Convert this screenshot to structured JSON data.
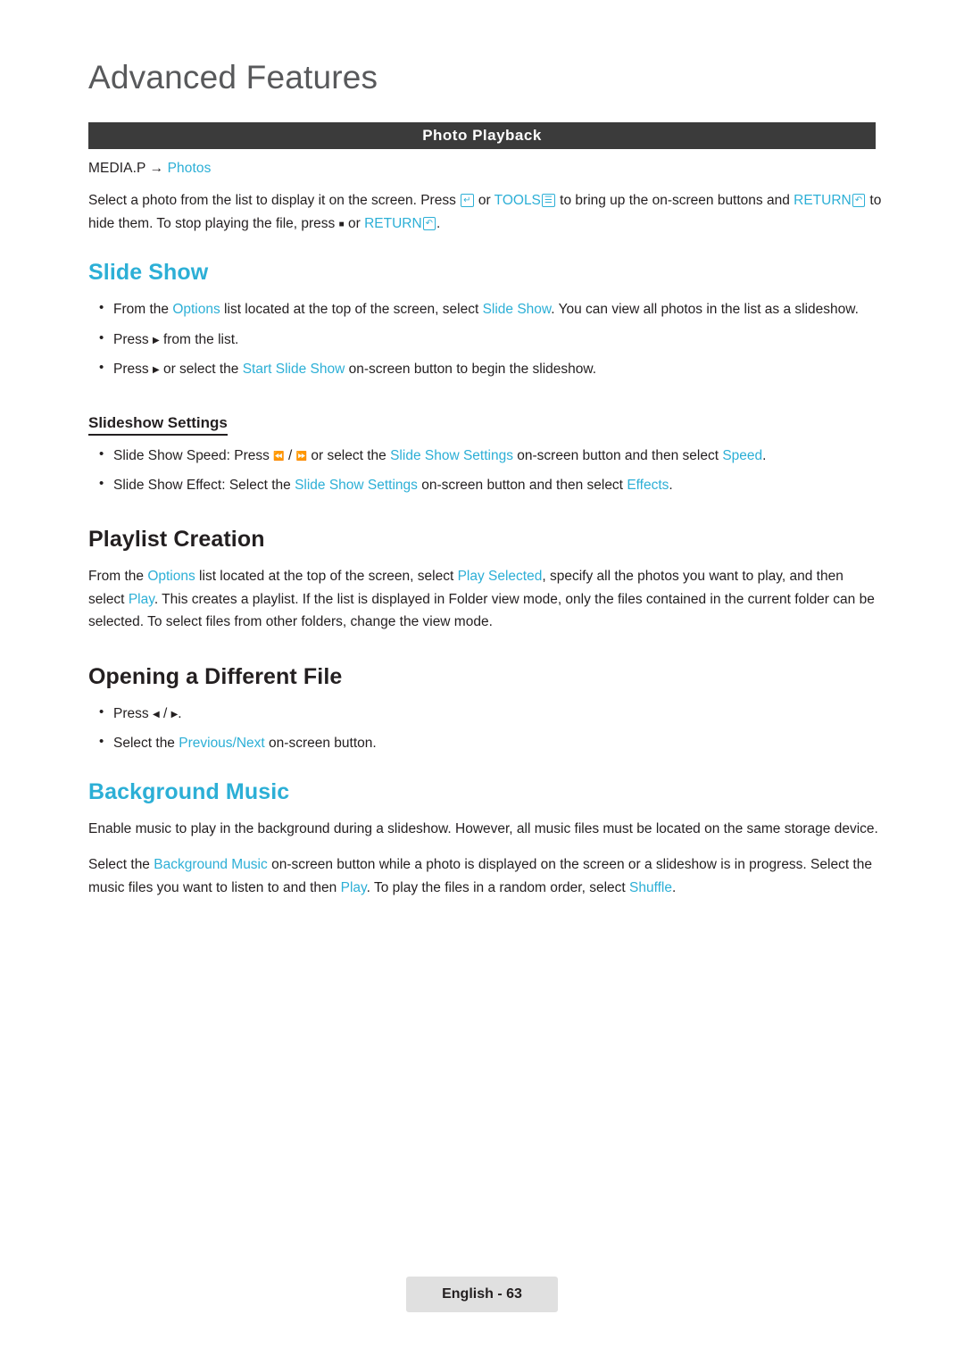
{
  "header": {
    "chapter_title": "Advanced Features",
    "section_bar_title": "Photo Playback"
  },
  "breadcrumb": {
    "root": "MEDIA.P",
    "arrow": "→",
    "leaf": "Photos"
  },
  "intro": {
    "t1": "Select a photo from the list to display it on the screen. Press ",
    "k_enter": "↵",
    "t2": " or ",
    "k_tools_label": "TOOLS",
    "k_tools": "☰",
    "t3": " to bring up the on-screen buttons and ",
    "k_return_label": "RETURN",
    "k_return": "↶",
    "t4": " to hide them. To stop playing the file, press ",
    "k_stop": "■",
    "t5": " or ",
    "k_return_label2": "RETURN",
    "k_return2": "↶",
    "t6": "."
  },
  "slide_show": {
    "heading": "Slide Show",
    "bullets": [
      {
        "parts": [
          {
            "text": "From the ",
            "style": "plain"
          },
          {
            "text": "Options",
            "style": "cyan"
          },
          {
            "text": " list located at the top of the screen, select ",
            "style": "plain"
          },
          {
            "text": "Slide Show",
            "style": "cyan"
          },
          {
            "text": ". You can view all photos in the list as a slideshow.",
            "style": "plain"
          }
        ]
      },
      {
        "parts": [
          {
            "text": "Press ",
            "style": "plain"
          },
          {
            "text": "▶",
            "style": "glyph-sm"
          },
          {
            "text": " from the list.",
            "style": "plain"
          }
        ]
      },
      {
        "parts": [
          {
            "text": "Press ",
            "style": "plain"
          },
          {
            "text": "▶",
            "style": "glyph-sm"
          },
          {
            "text": " or select the ",
            "style": "plain"
          },
          {
            "text": "Start Slide Show",
            "style": "cyan"
          },
          {
            "text": " on-screen button to begin the slideshow.",
            "style": "plain"
          }
        ]
      }
    ],
    "sub_heading": "Slideshow Settings",
    "sub_bullets": [
      {
        "parts": [
          {
            "text": "Slide Show Speed: Press ",
            "style": "plain"
          },
          {
            "text": "⏪",
            "style": "glyph-sm"
          },
          {
            "text": " / ",
            "style": "plain"
          },
          {
            "text": "⏩",
            "style": "glyph-sm"
          },
          {
            "text": " or select the ",
            "style": "plain"
          },
          {
            "text": "Slide Show Settings",
            "style": "cyan"
          },
          {
            "text": " on-screen button and then select ",
            "style": "plain"
          },
          {
            "text": "Speed",
            "style": "cyan"
          },
          {
            "text": ".",
            "style": "plain"
          }
        ]
      },
      {
        "parts": [
          {
            "text": "Slide Show Effect: Select the ",
            "style": "plain"
          },
          {
            "text": "Slide Show Settings",
            "style": "cyan"
          },
          {
            "text": " on-screen button and then select ",
            "style": "plain"
          },
          {
            "text": "Effects",
            "style": "cyan"
          },
          {
            "text": ".",
            "style": "plain"
          }
        ]
      }
    ]
  },
  "playlist_creation": {
    "heading": "Playlist Creation",
    "paragraph_parts": [
      {
        "text": "From the ",
        "style": "plain"
      },
      {
        "text": "Options",
        "style": "cyan"
      },
      {
        "text": " list located at the top of the screen, select ",
        "style": "plain"
      },
      {
        "text": "Play Selected",
        "style": "cyan"
      },
      {
        "text": ", specify all the photos you want to play, and then select ",
        "style": "plain"
      },
      {
        "text": "Play",
        "style": "cyan"
      },
      {
        "text": ". This creates a playlist. If the list is displayed in Folder view mode, only the files contained in the current folder can be selected. To select files from other folders, change the view mode.",
        "style": "plain"
      }
    ]
  },
  "opening_different_file": {
    "heading": "Opening a Different File",
    "bullets": [
      {
        "parts": [
          {
            "text": "Press ",
            "style": "plain"
          },
          {
            "text": "◀",
            "style": "glyph-cy"
          },
          {
            "text": " / ",
            "style": "plain"
          },
          {
            "text": "▶",
            "style": "glyph-cy"
          },
          {
            "text": ".",
            "style": "plain"
          }
        ]
      },
      {
        "parts": [
          {
            "text": "Select the ",
            "style": "plain"
          },
          {
            "text": "Previous/Next",
            "style": "cyan"
          },
          {
            "text": " on-screen button.",
            "style": "plain"
          }
        ]
      }
    ]
  },
  "background_music": {
    "heading": "Background Music",
    "paragraph1": "Enable music to play in the background during a slideshow. However, all music files must be located on the same storage device.",
    "paragraph2_parts": [
      {
        "text": "Select the ",
        "style": "plain"
      },
      {
        "text": "Background Music",
        "style": "cyan"
      },
      {
        "text": " on-screen button while a photo is displayed on the screen or a slideshow is in progress. Select the music files you want to listen to and then ",
        "style": "plain"
      },
      {
        "text": "Play",
        "style": "cyan"
      },
      {
        "text": ". To play the files in a random order, select ",
        "style": "plain"
      },
      {
        "text": "Shuffle",
        "style": "cyan"
      },
      {
        "text": ".",
        "style": "plain"
      }
    ]
  },
  "footer": {
    "page_label": "English - 63"
  },
  "colors": {
    "accent": "#2cafd6",
    "bar": "#3b3b3b",
    "title": "#58595b",
    "text": "#231f20",
    "footer_bg": "#e0e0e0"
  }
}
